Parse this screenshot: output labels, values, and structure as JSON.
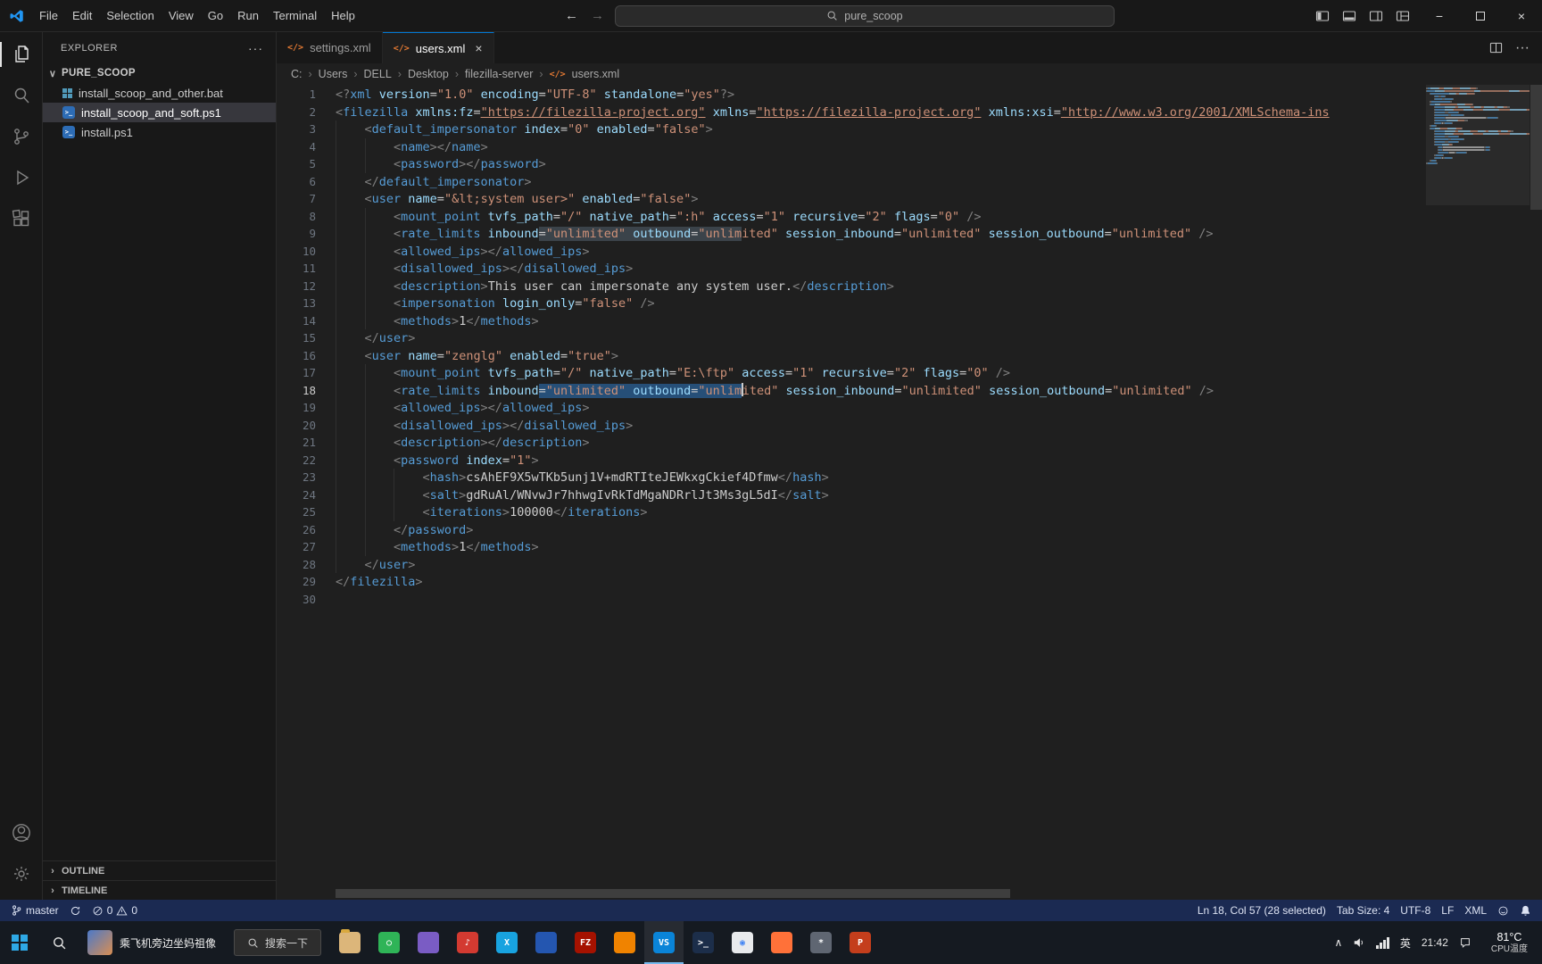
{
  "theme": {
    "accent": "#0078d4",
    "selection": "#264f78",
    "status-bg": "#1b2a52"
  },
  "icons": {
    "xml_glyph": "</>",
    "back": "←",
    "forward": "→",
    "more": "···",
    "chevron_down": "∨",
    "chevron_right": "›",
    "tray_chevron": "∧",
    "minimize": "−",
    "close": "×"
  },
  "titlebar": {
    "menus": [
      "File",
      "Edit",
      "Selection",
      "View",
      "Go",
      "Run",
      "Terminal",
      "Help"
    ],
    "search_value": "pure_scoop"
  },
  "explorer": {
    "title": "EXPLORER",
    "root": "PURE_SCOOP",
    "files": [
      {
        "name": "install_scoop_and_other.bat",
        "type": "bat",
        "selected": false
      },
      {
        "name": "install_scoop_and_soft.ps1",
        "type": "ps1",
        "selected": true
      },
      {
        "name": "install.ps1",
        "type": "ps1",
        "selected": false
      }
    ],
    "outline": "OUTLINE",
    "timeline": "TIMELINE"
  },
  "tabs": [
    {
      "label": "settings.xml"
    },
    {
      "label": "users.xml",
      "close": "×"
    }
  ],
  "breadcrumb": [
    "C:",
    "Users",
    "DELL",
    "Desktop",
    "filezilla-server",
    "users.xml"
  ],
  "editor": {
    "lines": [
      {
        "i": 0,
        "s": [
          [
            "p",
            "<?"
          ],
          [
            "t",
            "xml"
          ],
          [
            "a",
            " version"
          ],
          [
            "e",
            "="
          ],
          [
            "v",
            "\"1.0\""
          ],
          [
            "a",
            " encoding"
          ],
          [
            "e",
            "="
          ],
          [
            "v",
            "\"UTF-8\""
          ],
          [
            "a",
            " standalone"
          ],
          [
            "e",
            "="
          ],
          [
            "v",
            "\"yes\""
          ],
          [
            "p",
            "?>"
          ]
        ]
      },
      {
        "i": 0,
        "s": [
          [
            "p",
            "<"
          ],
          [
            "t",
            "filezilla"
          ],
          [
            "a",
            " xmlns:fz"
          ],
          [
            "e",
            "="
          ],
          [
            "l",
            "\"https://filezilla-project.org\""
          ],
          [
            "a",
            " xmlns"
          ],
          [
            "e",
            "="
          ],
          [
            "l",
            "\"https://filezilla-project.org\""
          ],
          [
            "a",
            " xmlns:xsi"
          ],
          [
            "e",
            "="
          ],
          [
            "l",
            "\"http://www.w3.org/2001/XMLSchema-ins"
          ]
        ]
      },
      {
        "i": 1,
        "s": [
          [
            "p",
            "<"
          ],
          [
            "t",
            "default_impersonator"
          ],
          [
            "a",
            " index"
          ],
          [
            "e",
            "="
          ],
          [
            "v",
            "\"0\""
          ],
          [
            "a",
            " enabled"
          ],
          [
            "e",
            "="
          ],
          [
            "v",
            "\"false\""
          ],
          [
            "p",
            ">"
          ]
        ]
      },
      {
        "i": 2,
        "s": [
          [
            "p",
            "<"
          ],
          [
            "t",
            "name"
          ],
          [
            "p",
            "></"
          ],
          [
            "t",
            "name"
          ],
          [
            "p",
            ">"
          ]
        ]
      },
      {
        "i": 2,
        "s": [
          [
            "p",
            "<"
          ],
          [
            "t",
            "password"
          ],
          [
            "p",
            "></"
          ],
          [
            "t",
            "password"
          ],
          [
            "p",
            ">"
          ]
        ]
      },
      {
        "i": 1,
        "s": [
          [
            "p",
            "</"
          ],
          [
            "t",
            "default_impersonator"
          ],
          [
            "p",
            ">"
          ]
        ]
      },
      {
        "i": 1,
        "s": [
          [
            "p",
            "<"
          ],
          [
            "t",
            "user"
          ],
          [
            "a",
            " name"
          ],
          [
            "e",
            "="
          ],
          [
            "v",
            "\"&lt;system user>\""
          ],
          [
            "a",
            " enabled"
          ],
          [
            "e",
            "="
          ],
          [
            "v",
            "\"false\""
          ],
          [
            "p",
            ">"
          ]
        ]
      },
      {
        "i": 2,
        "s": [
          [
            "p",
            "<"
          ],
          [
            "t",
            "mount_point"
          ],
          [
            "a",
            " tvfs_path"
          ],
          [
            "e",
            "="
          ],
          [
            "v",
            "\"/\""
          ],
          [
            "a",
            " native_path"
          ],
          [
            "e",
            "="
          ],
          [
            "v",
            "\":h\""
          ],
          [
            "a",
            " access"
          ],
          [
            "e",
            "="
          ],
          [
            "v",
            "\"1\""
          ],
          [
            "a",
            " recursive"
          ],
          [
            "e",
            "="
          ],
          [
            "v",
            "\"2\""
          ],
          [
            "a",
            " flags"
          ],
          [
            "e",
            "="
          ],
          [
            "v",
            "\"0\""
          ],
          [
            "p",
            " />"
          ]
        ]
      },
      {
        "i": 2,
        "s": [
          [
            "p",
            "<"
          ],
          [
            "t",
            "rate_limits"
          ],
          [
            "a",
            " inbound"
          ],
          [
            "e",
            "=",
            "h"
          ],
          [
            "v",
            "\"unlimited\"",
            "h"
          ],
          [
            "a",
            " outbound",
            "h"
          ],
          [
            "e",
            "=",
            "h"
          ],
          [
            "v",
            "\"unlim",
            "h"
          ],
          [
            "v",
            "ited\""
          ],
          [
            "a",
            " session_inbound"
          ],
          [
            "e",
            "="
          ],
          [
            "v",
            "\"unlimited\""
          ],
          [
            "a",
            " session_outbound"
          ],
          [
            "e",
            "="
          ],
          [
            "v",
            "\"unlimited\""
          ],
          [
            "p",
            " />"
          ]
        ]
      },
      {
        "i": 2,
        "s": [
          [
            "p",
            "<"
          ],
          [
            "t",
            "allowed_ips"
          ],
          [
            "p",
            "></"
          ],
          [
            "t",
            "allowed_ips"
          ],
          [
            "p",
            ">"
          ]
        ]
      },
      {
        "i": 2,
        "s": [
          [
            "p",
            "<"
          ],
          [
            "t",
            "disallowed_ips"
          ],
          [
            "p",
            "></"
          ],
          [
            "t",
            "disallowed_ips"
          ],
          [
            "p",
            ">"
          ]
        ]
      },
      {
        "i": 2,
        "s": [
          [
            "p",
            "<"
          ],
          [
            "t",
            "description"
          ],
          [
            "p",
            ">"
          ],
          [
            "x",
            "This user can impersonate any system user."
          ],
          [
            "p",
            "</"
          ],
          [
            "t",
            "description"
          ],
          [
            "p",
            ">"
          ]
        ]
      },
      {
        "i": 2,
        "s": [
          [
            "p",
            "<"
          ],
          [
            "t",
            "impersonation"
          ],
          [
            "a",
            " login_only"
          ],
          [
            "e",
            "="
          ],
          [
            "v",
            "\"false\""
          ],
          [
            "p",
            " />"
          ]
        ]
      },
      {
        "i": 2,
        "s": [
          [
            "p",
            "<"
          ],
          [
            "t",
            "methods"
          ],
          [
            "p",
            ">"
          ],
          [
            "x",
            "1"
          ],
          [
            "p",
            "</"
          ],
          [
            "t",
            "methods"
          ],
          [
            "p",
            ">"
          ]
        ]
      },
      {
        "i": 1,
        "s": [
          [
            "p",
            "</"
          ],
          [
            "t",
            "user"
          ],
          [
            "p",
            ">"
          ]
        ]
      },
      {
        "i": 1,
        "s": [
          [
            "p",
            "<"
          ],
          [
            "t",
            "user"
          ],
          [
            "a",
            " name"
          ],
          [
            "e",
            "="
          ],
          [
            "v",
            "\"zenglg\""
          ],
          [
            "a",
            " enabled"
          ],
          [
            "e",
            "="
          ],
          [
            "v",
            "\"true\""
          ],
          [
            "p",
            ">"
          ]
        ]
      },
      {
        "i": 2,
        "s": [
          [
            "p",
            "<"
          ],
          [
            "t",
            "mount_point"
          ],
          [
            "a",
            " tvfs_path"
          ],
          [
            "e",
            "="
          ],
          [
            "v",
            "\"/\""
          ],
          [
            "a",
            " native_path"
          ],
          [
            "e",
            "="
          ],
          [
            "v",
            "\"E:\\ftp\""
          ],
          [
            "a",
            " access"
          ],
          [
            "e",
            "="
          ],
          [
            "v",
            "\"1\""
          ],
          [
            "a",
            " recursive"
          ],
          [
            "e",
            "="
          ],
          [
            "v",
            "\"2\""
          ],
          [
            "a",
            " flags"
          ],
          [
            "e",
            "="
          ],
          [
            "v",
            "\"0\""
          ],
          [
            "p",
            " />"
          ]
        ]
      },
      {
        "i": 2,
        "cur": true,
        "s": [
          [
            "p",
            "<"
          ],
          [
            "t",
            "rate_limits"
          ],
          [
            "a",
            " inbound"
          ],
          [
            "e",
            "=",
            "s"
          ],
          [
            "v",
            "\"unlimited\"",
            "s"
          ],
          [
            "a",
            " outbound",
            "s"
          ],
          [
            "e",
            "=",
            "s"
          ],
          [
            "v",
            "\"unlim",
            "s"
          ],
          [
            "v",
            "ited\"",
            "c"
          ],
          [
            "a",
            " session_inbound"
          ],
          [
            "e",
            "="
          ],
          [
            "v",
            "\"unlimited\""
          ],
          [
            "a",
            " session_outbound"
          ],
          [
            "e",
            "="
          ],
          [
            "v",
            "\"unlimited\""
          ],
          [
            "p",
            " />"
          ]
        ]
      },
      {
        "i": 2,
        "s": [
          [
            "p",
            "<"
          ],
          [
            "t",
            "allowed_ips"
          ],
          [
            "p",
            "></"
          ],
          [
            "t",
            "allowed_ips"
          ],
          [
            "p",
            ">"
          ]
        ]
      },
      {
        "i": 2,
        "s": [
          [
            "p",
            "<"
          ],
          [
            "t",
            "disallowed_ips"
          ],
          [
            "p",
            "></"
          ],
          [
            "t",
            "disallowed_ips"
          ],
          [
            "p",
            ">"
          ]
        ]
      },
      {
        "i": 2,
        "s": [
          [
            "p",
            "<"
          ],
          [
            "t",
            "description"
          ],
          [
            "p",
            "></"
          ],
          [
            "t",
            "description"
          ],
          [
            "p",
            ">"
          ]
        ]
      },
      {
        "i": 2,
        "s": [
          [
            "p",
            "<"
          ],
          [
            "t",
            "password"
          ],
          [
            "a",
            " index"
          ],
          [
            "e",
            "="
          ],
          [
            "v",
            "\"1\""
          ],
          [
            "p",
            ">"
          ]
        ]
      },
      {
        "i": 3,
        "s": [
          [
            "p",
            "<"
          ],
          [
            "t",
            "hash"
          ],
          [
            "p",
            ">"
          ],
          [
            "x",
            "csAhEF9X5wTKb5unj1V+mdRTIteJEWkxgCkief4Dfmw"
          ],
          [
            "p",
            "</"
          ],
          [
            "t",
            "hash"
          ],
          [
            "p",
            ">"
          ]
        ]
      },
      {
        "i": 3,
        "s": [
          [
            "p",
            "<"
          ],
          [
            "t",
            "salt"
          ],
          [
            "p",
            ">"
          ],
          [
            "x",
            "gdRuAl/WNvwJr7hhwgIvRkTdMgaNDRrlJt3Ms3gL5dI"
          ],
          [
            "p",
            "</"
          ],
          [
            "t",
            "salt"
          ],
          [
            "p",
            ">"
          ]
        ]
      },
      {
        "i": 3,
        "s": [
          [
            "p",
            "<"
          ],
          [
            "t",
            "iterations"
          ],
          [
            "p",
            ">"
          ],
          [
            "x",
            "100000"
          ],
          [
            "p",
            "</"
          ],
          [
            "t",
            "iterations"
          ],
          [
            "p",
            ">"
          ]
        ]
      },
      {
        "i": 2,
        "s": [
          [
            "p",
            "</"
          ],
          [
            "t",
            "password"
          ],
          [
            "p",
            ">"
          ]
        ]
      },
      {
        "i": 2,
        "s": [
          [
            "p",
            "<"
          ],
          [
            "t",
            "methods"
          ],
          [
            "p",
            ">"
          ],
          [
            "x",
            "1"
          ],
          [
            "p",
            "</"
          ],
          [
            "t",
            "methods"
          ],
          [
            "p",
            ">"
          ]
        ]
      },
      {
        "i": 1,
        "s": [
          [
            "p",
            "</"
          ],
          [
            "t",
            "user"
          ],
          [
            "p",
            ">"
          ]
        ]
      },
      {
        "i": 0,
        "s": [
          [
            "p",
            "</"
          ],
          [
            "t",
            "filezilla"
          ],
          [
            "p",
            ">"
          ]
        ]
      },
      {
        "i": 0,
        "s": []
      }
    ]
  },
  "statusbar": {
    "branch": "master",
    "errors": "0",
    "warnings": "0",
    "position": "Ln 18, Col 57 (28 selected)",
    "tab_size": "Tab Size: 4",
    "encoding": "UTF-8",
    "eol": "LF",
    "language": "XML"
  },
  "taskbar": {
    "widget_text": "乘飞机旁边坐妈祖像",
    "search_text": "搜索一下",
    "tray_lang": "英",
    "tray_time": "21:42",
    "temp": "81°C",
    "temp_label": "CPU温度",
    "apps": [
      {
        "id": "file-explorer",
        "bg": "#dcb67a",
        "glyph": ""
      },
      {
        "id": "browser-green",
        "bg": "#2fb457",
        "glyph": "○"
      },
      {
        "id": "app-purple",
        "bg": "#7a5cc4",
        "glyph": ""
      },
      {
        "id": "music-red",
        "bg": "#d33a31",
        "glyph": "♪"
      },
      {
        "id": "thunder-blue",
        "bg": "#18a3e0",
        "glyph": "X"
      },
      {
        "id": "app-navy",
        "bg": "#2456b0",
        "glyph": ""
      },
      {
        "id": "filezilla",
        "bg": "#a51200",
        "glyph": "FZ"
      },
      {
        "id": "app-orange",
        "bg": "#f08300",
        "glyph": ""
      },
      {
        "id": "vscode",
        "bg": "#0a84d8",
        "glyph": "VS",
        "active": true
      },
      {
        "id": "powershell",
        "bg": "#1c2e4a",
        "glyph": ">_"
      },
      {
        "id": "chrome",
        "bg": "#e8eaed",
        "glyph": "◉",
        "fg": "#4285f4"
      },
      {
        "id": "firefox",
        "bg": "#ff7139",
        "glyph": ""
      },
      {
        "id": "settings",
        "bg": "#5f6672",
        "glyph": "*"
      },
      {
        "id": "powerpoint",
        "bg": "#c43e1c",
        "glyph": "P"
      }
    ]
  }
}
